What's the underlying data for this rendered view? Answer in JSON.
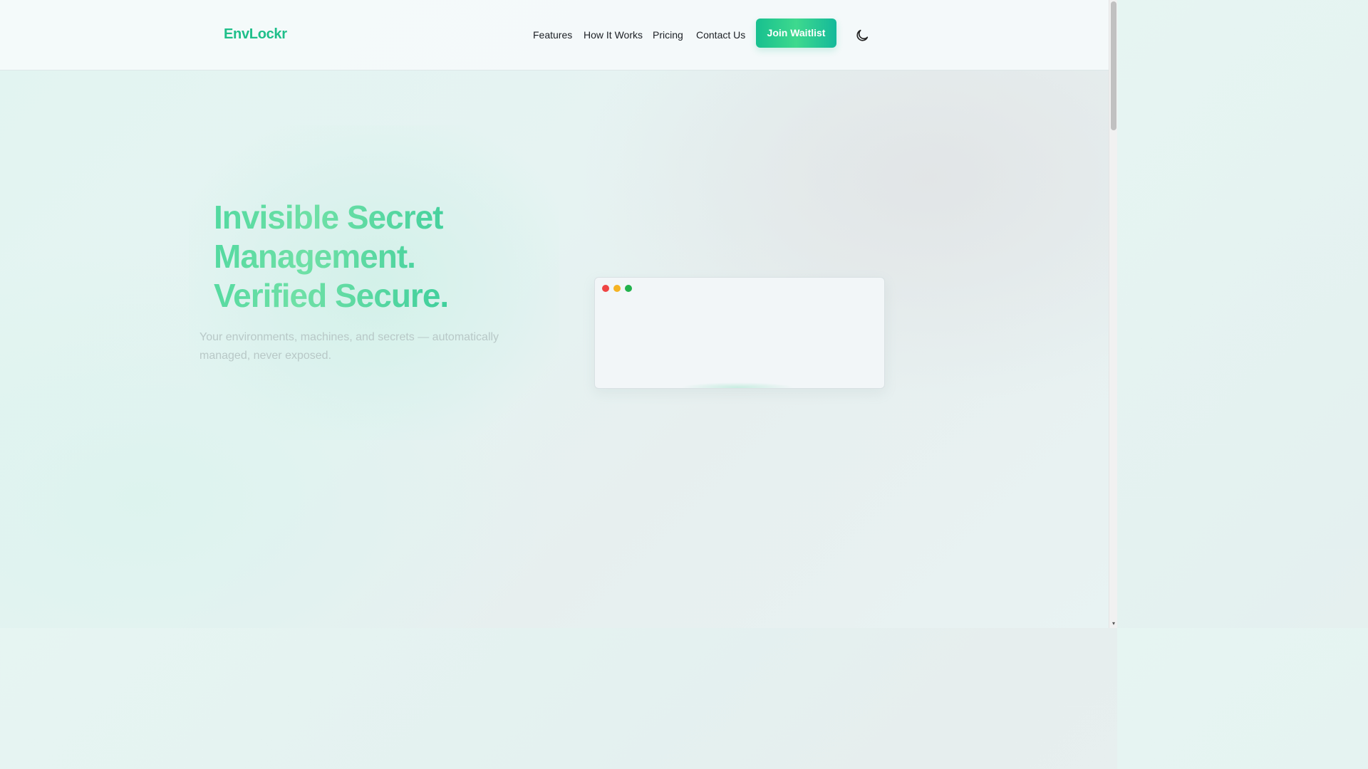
{
  "header": {
    "logo": "EnvLockr",
    "nav": [
      "Features",
      "How It Works",
      "Pricing",
      "Contact Us"
    ],
    "cta_label": "Join Waitlist",
    "theme_toggle_icon": "moon-icon"
  },
  "hero": {
    "headline": [
      "Invisible Secret",
      "Management.",
      "Verified Secure."
    ],
    "subtext": "Your environments, machines, and secrets — automatically managed, never exposed."
  },
  "terminal": {
    "dots": [
      "#ef4444",
      "#f5b324",
      "#22b24c"
    ]
  },
  "colors": {
    "brand": "#1fbf8a",
    "accent": "#3ed98e"
  }
}
